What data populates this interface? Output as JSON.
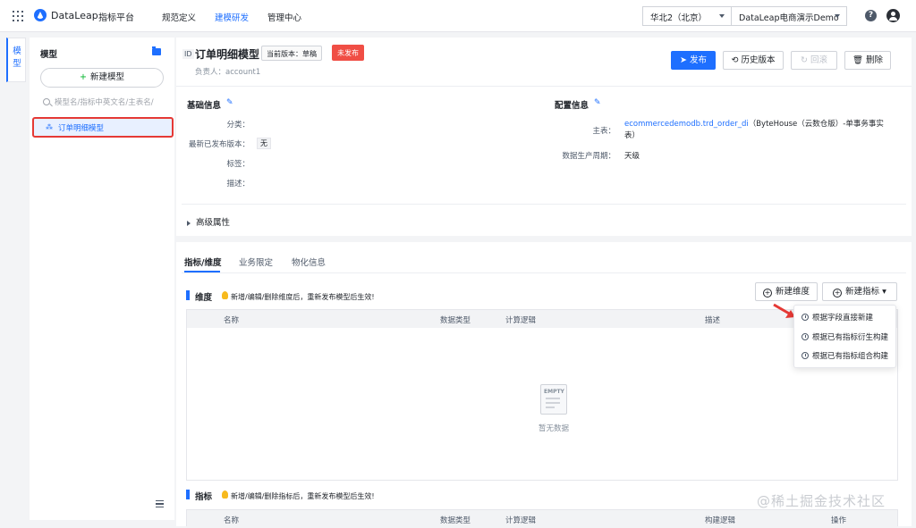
{
  "topbar": {
    "brand": "DataLeap",
    "platform": "指标平台",
    "nav": [
      "规范定义",
      "建模研发",
      "管理中心"
    ],
    "region": "华北2（北京）",
    "project": "DataLeap电商演示Demo"
  },
  "left_rail": {
    "label": "模型"
  },
  "sidebar": {
    "title": "模型",
    "new_model": "新建模型",
    "search_placeholder": "模型名/指标中英文名/主表名/",
    "selected_item": "订单明细模型"
  },
  "header": {
    "id_badge": "ID",
    "title": "订单明细模型",
    "version": "当前版本：草稿",
    "status": "未发布",
    "owner": "负责人：account1",
    "buttons": {
      "publish": "发布",
      "history": "历史版本",
      "rollback": "回滚",
      "delete": "删除"
    }
  },
  "basic_info": {
    "title": "基础信息",
    "fields": [
      {
        "label": "分类：",
        "value": ""
      },
      {
        "label": "最新已发布版本：",
        "value": "无"
      },
      {
        "label": "标签：",
        "value": ""
      },
      {
        "label": "描述：",
        "value": ""
      }
    ]
  },
  "config_info": {
    "title": "配置信息",
    "main_table_label": "主表：",
    "main_table_link": "ecommercedemodb.trd_order_di",
    "main_table_suffix_1": "（ByteHouse（云数仓版）-单事务事实",
    "main_table_suffix_2": "表）",
    "period_label": "数据生产周期：",
    "period_value": "天级"
  },
  "advanced": "高级属性",
  "tabs": [
    "指标/维度",
    "业务限定",
    "物化信息"
  ],
  "dimension_block": {
    "title": "维度",
    "hint": "新增/编辑/删除维度后，重新发布模型后生效!",
    "new_dimension": "新建维度",
    "new_metric": "新建指标",
    "columns": [
      "名称",
      "数据类型",
      "计算逻辑",
      "描述"
    ],
    "empty_text": "暂无数据",
    "empty_badge": "EMPTY"
  },
  "metric_block": {
    "title": "指标",
    "hint": "新增/编辑/删除指标后，重新发布模型后生效!",
    "columns": [
      "名称",
      "数据类型",
      "计算逻辑",
      "构建逻辑",
      "操作"
    ]
  },
  "dropdown": [
    "根据字段直接新建",
    "根据已有指标衍生构建",
    "根据已有指标组合构建"
  ],
  "watermark": "@稀土掘金技术社区",
  "colors": {
    "accent": "#1e6fff",
    "danger": "#f04e45",
    "highlight": "#e53935"
  }
}
